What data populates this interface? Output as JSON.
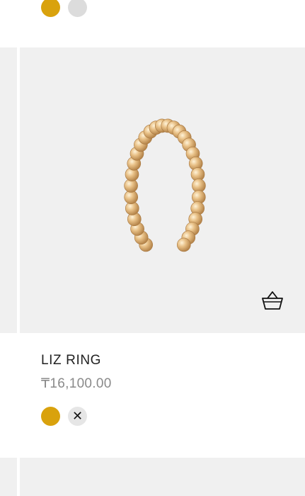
{
  "top_swatches": [
    {
      "name": "gold",
      "color": "#d9a20d"
    },
    {
      "name": "silver",
      "color": "#dcdcdc"
    }
  ],
  "product": {
    "title": "LIZ RING",
    "price": "₸16,100.00",
    "image_icon": "ring-image",
    "cart_icon": "basket-icon",
    "swatches": [
      {
        "name": "gold",
        "color": "#d9a20d",
        "selected": true
      },
      {
        "name": "unavailable",
        "color": "#e6e6e6",
        "label": "✕"
      }
    ]
  },
  "colors": {
    "image_bg": "#f0f0f0",
    "title": "#222222",
    "price": "#8a8a8a"
  }
}
